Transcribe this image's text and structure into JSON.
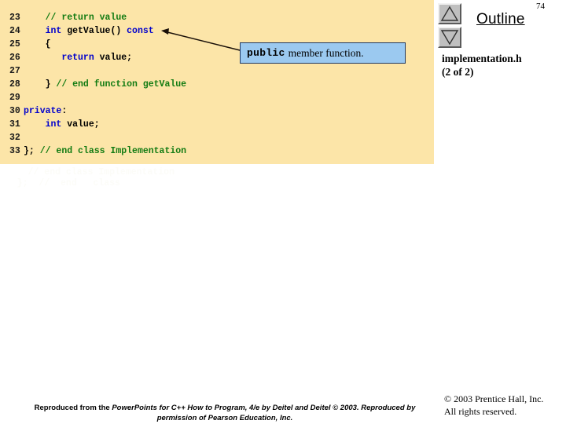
{
  "slide": {
    "page_number": "74",
    "outline_title": "Outline",
    "file_label_line1": "implementation.h",
    "file_label_line2": "(2 of 2)"
  },
  "colors": {
    "code_background": "#FCE5A8",
    "keyword": "#0000CC",
    "comment": "#127B12",
    "code_text": "#000000",
    "callout_background": "#9BC9F0",
    "callout_border": "#1F3864",
    "button_face": "#BFBFBF"
  },
  "code": {
    "lines": [
      {
        "number": "23",
        "tokens": [
          {
            "t": "    ",
            "c": "plain"
          },
          {
            "t": "// return value",
            "c": "cmt"
          }
        ]
      },
      {
        "number": "24",
        "tokens": [
          {
            "t": "    ",
            "c": "plain"
          },
          {
            "t": "int",
            "c": "kw"
          },
          {
            "t": " getValue() ",
            "c": "plain"
          },
          {
            "t": "const",
            "c": "kw"
          }
        ]
      },
      {
        "number": "25",
        "tokens": [
          {
            "t": "    {",
            "c": "plain"
          }
        ]
      },
      {
        "number": "26",
        "tokens": [
          {
            "t": "       ",
            "c": "plain"
          },
          {
            "t": "return",
            "c": "kw"
          },
          {
            "t": " value;",
            "c": "plain"
          }
        ]
      },
      {
        "number": "27",
        "tokens": [
          {
            "t": "",
            "c": "plain"
          }
        ]
      },
      {
        "number": "28",
        "tokens": [
          {
            "t": "    } ",
            "c": "plain"
          },
          {
            "t": "// end function getValue",
            "c": "cmt"
          }
        ]
      },
      {
        "number": "29",
        "tokens": [
          {
            "t": "",
            "c": "plain"
          }
        ]
      },
      {
        "number": "30",
        "tokens": [
          {
            "t": "private",
            "c": "kw"
          },
          {
            "t": ":",
            "c": "plain"
          }
        ]
      },
      {
        "number": "31",
        "tokens": [
          {
            "t": "    ",
            "c": "plain"
          },
          {
            "t": "int",
            "c": "kw"
          },
          {
            "t": " value;",
            "c": "plain"
          }
        ]
      },
      {
        "number": "32",
        "tokens": [
          {
            "t": "",
            "c": "plain"
          }
        ]
      },
      {
        "number": "33",
        "tokens": [
          {
            "t": "}; ",
            "c": "plain"
          },
          {
            "t": "// end class Implementation",
            "c": "cmt"
          }
        ]
      }
    ]
  },
  "callout": {
    "code_word": "public",
    "rest_text": "member function."
  },
  "sidebar": {
    "scroll_up_icon": "triangle-up-icon",
    "scroll_down_icon": "triangle-down-icon"
  },
  "footer": {
    "attribution_prefix": "Reproduced from the ",
    "attribution_italic": "PowerPoints for C++ How to Program, 4/e by Deitel and Deitel © 2003. Reproduced by permission of Pearson Education, Inc.",
    "copyright_line1": "© 2003 Prentice Hall, Inc.",
    "copyright_line2": "All rights reserved."
  }
}
